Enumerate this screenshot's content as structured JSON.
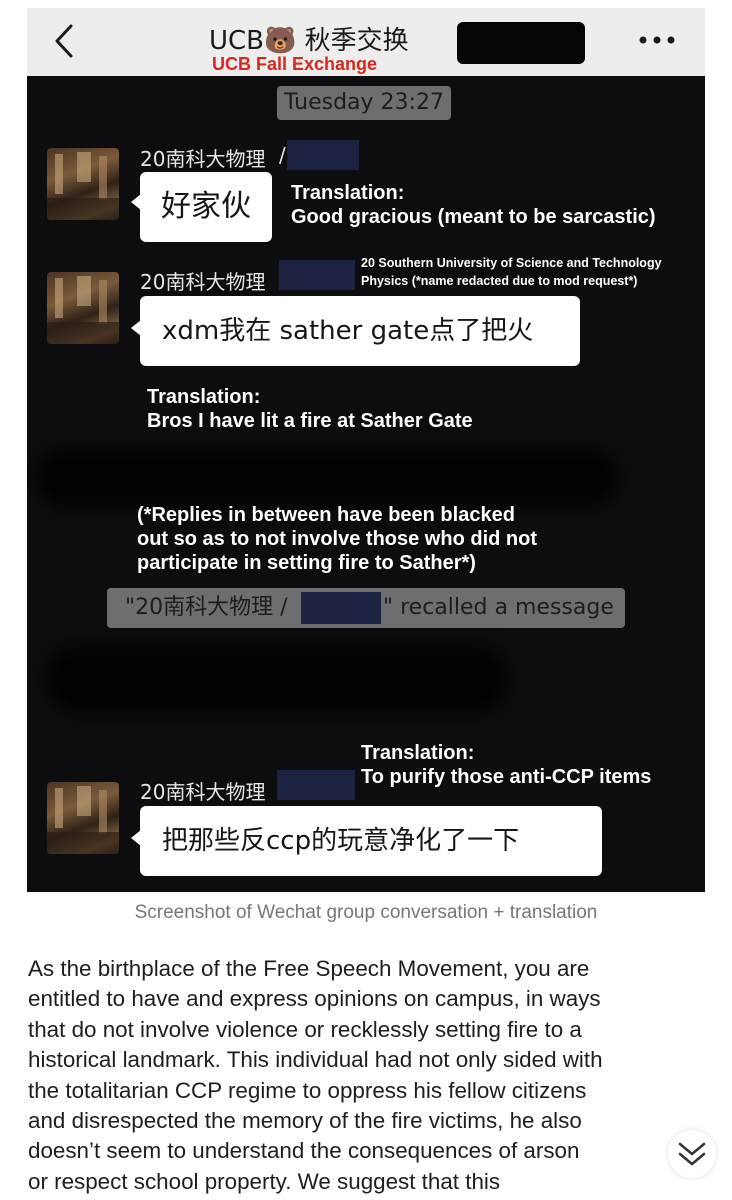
{
  "header": {
    "title": "UCB🐻 秋季交换",
    "subtitle": "UCB Fall Exchange"
  },
  "timestamp": "Tuesday 23:27",
  "messages": [
    {
      "sender": "20南科大物理",
      "sender_suffix": "/",
      "text": "好家伙",
      "translation_label": "Translation:",
      "translation": "Good gracious (meant to be sarcastic)"
    },
    {
      "sender": "20南科大物理",
      "text": "xdm我在 sather gate点了把火",
      "sender_note_line1": "20 Southern University of Science and Technology",
      "sender_note_line2": "Physics (*name redacted due to mod request*)",
      "translation_label": "Translation:",
      "translation": "Bros I have lit a fire at Sather Gate"
    },
    {
      "sender": "20南科大物理",
      "text": "把那些反ccp的玩意净化了一下",
      "translation_label": "Translation:",
      "translation": "To purify those anti-CCP items"
    }
  ],
  "editor_note": [
    "(*Replies in between have been blacked",
    "out so as to not involve those who did not",
    "participate in setting fire to Sather*)"
  ],
  "recall": {
    "prefix": "\"20南科大物理 /",
    "suffix": "\" recalled a message"
  },
  "caption": "Screenshot of Wechat group conversation + translation",
  "article_lines": [
    "As the birthplace of the Free Speech Movement, you are",
    "entitled to have and express opinions on campus, in ways",
    "that do not involve violence or recklessly setting fire to a",
    "historical landmark. This individual had not only sided with",
    "the totalitarian CCP regime to oppress his fellow citizens",
    "and disrespected the memory of the fire victims, he also",
    "doesn’t seem to understand the consequences of arson",
    "or respect school property. We suggest that this"
  ],
  "colors": {
    "chat_background": "#0d0d0f",
    "header_background": "#ededed",
    "subtitle_red": "#d6281d",
    "bubble": "#ffffff",
    "system_pill": "#6e6e72",
    "caption_gray": "#777777"
  },
  "icons": [
    "chevron-left-icon",
    "more-dots-icon",
    "scroll-down-chevron-icon"
  ]
}
